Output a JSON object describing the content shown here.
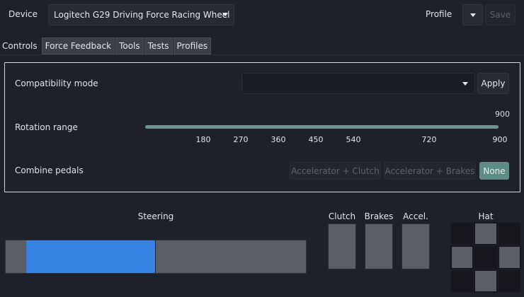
{
  "header": {
    "device_label": "Device",
    "device_selected": "Logitech G29 Driving Force Racing Wheel",
    "profile_label": "Profile",
    "save_label": "Save"
  },
  "tabs": [
    {
      "label": "Controls",
      "active": true
    },
    {
      "label": "Force Feedback",
      "active": false
    },
    {
      "label": "Tools",
      "active": false
    },
    {
      "label": "Tests",
      "active": false
    },
    {
      "label": "Profiles",
      "active": false
    }
  ],
  "controls": {
    "compat_label": "Compatibility mode",
    "compat_value": "",
    "apply_label": "Apply",
    "rotation_label": "Rotation range",
    "rotation_value": "900",
    "rotation_fraction": 1.0,
    "rotation_ticks": [
      "180",
      "270",
      "360",
      "450",
      "540",
      "720",
      "900"
    ],
    "combine_label": "Combine pedals",
    "combine_options": [
      {
        "label": "Accelerator + Clutch",
        "active": false
      },
      {
        "label": "Accelerator + Brakes",
        "active": false
      },
      {
        "label": "None",
        "active": true
      }
    ]
  },
  "gauges": {
    "steering_label": "Steering",
    "clutch_label": "Clutch",
    "brakes_label": "Brakes",
    "accel_label": "Accel.",
    "hat_label": "Hat"
  },
  "colors": {
    "accent": "#5e8d86",
    "steering_fill": "#3584e4"
  }
}
